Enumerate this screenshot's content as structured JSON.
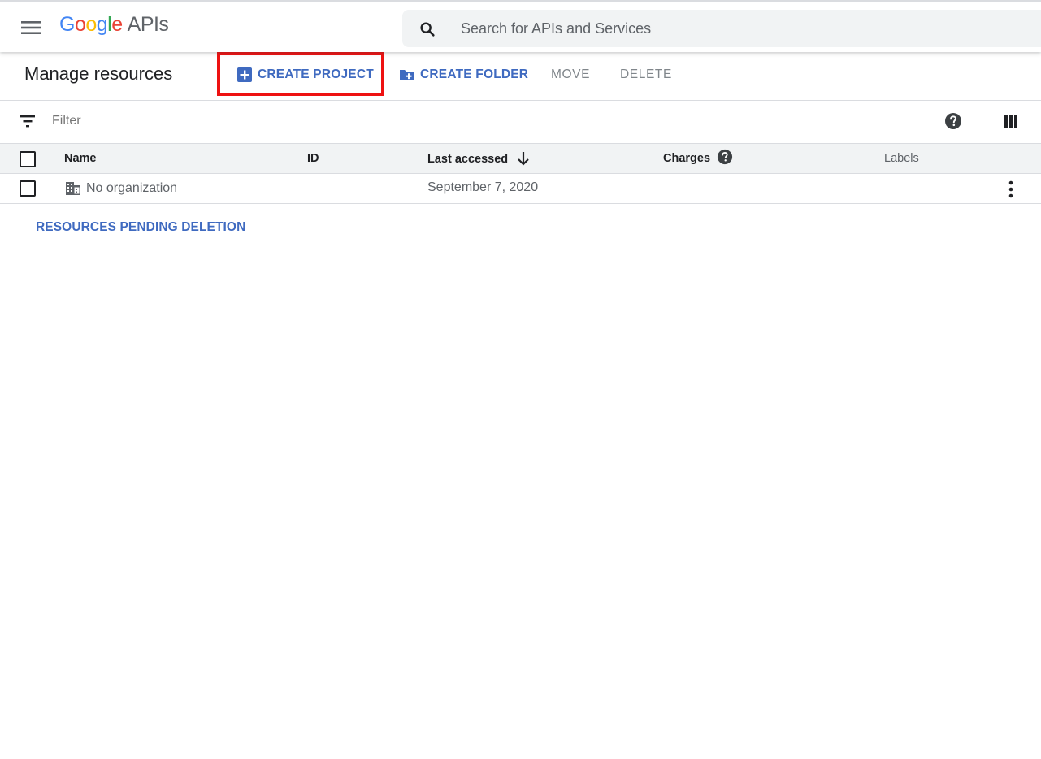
{
  "header": {
    "logo_google": [
      "G",
      "o",
      "o",
      "g",
      "l",
      "e"
    ],
    "logo_colors": [
      "#4285F4",
      "#EA4335",
      "#FBBC05",
      "#4285F4",
      "#34A853",
      "#EA4335"
    ],
    "logo_suffix": "APIs",
    "search_placeholder": "Search for APIs and Services"
  },
  "toolbar": {
    "title": "Manage resources",
    "create_project": "CREATE PROJECT",
    "create_folder": "CREATE FOLDER",
    "move": "MOVE",
    "delete": "DELETE",
    "highlight_color": "#ee1111",
    "accent_color": "#3f6ac0"
  },
  "filter": {
    "placeholder": "Filter"
  },
  "table": {
    "columns": {
      "name": "Name",
      "id": "ID",
      "last_accessed": "Last accessed",
      "charges": "Charges",
      "labels": "Labels"
    },
    "sort": "last_accessed descending",
    "rows": [
      {
        "icon": "building-icon",
        "name": "No organization",
        "id": "",
        "last_accessed": "September 7, 2020",
        "charges": "",
        "labels": ""
      }
    ]
  },
  "links": {
    "pending_deletion": "RESOURCES PENDING DELETION"
  }
}
